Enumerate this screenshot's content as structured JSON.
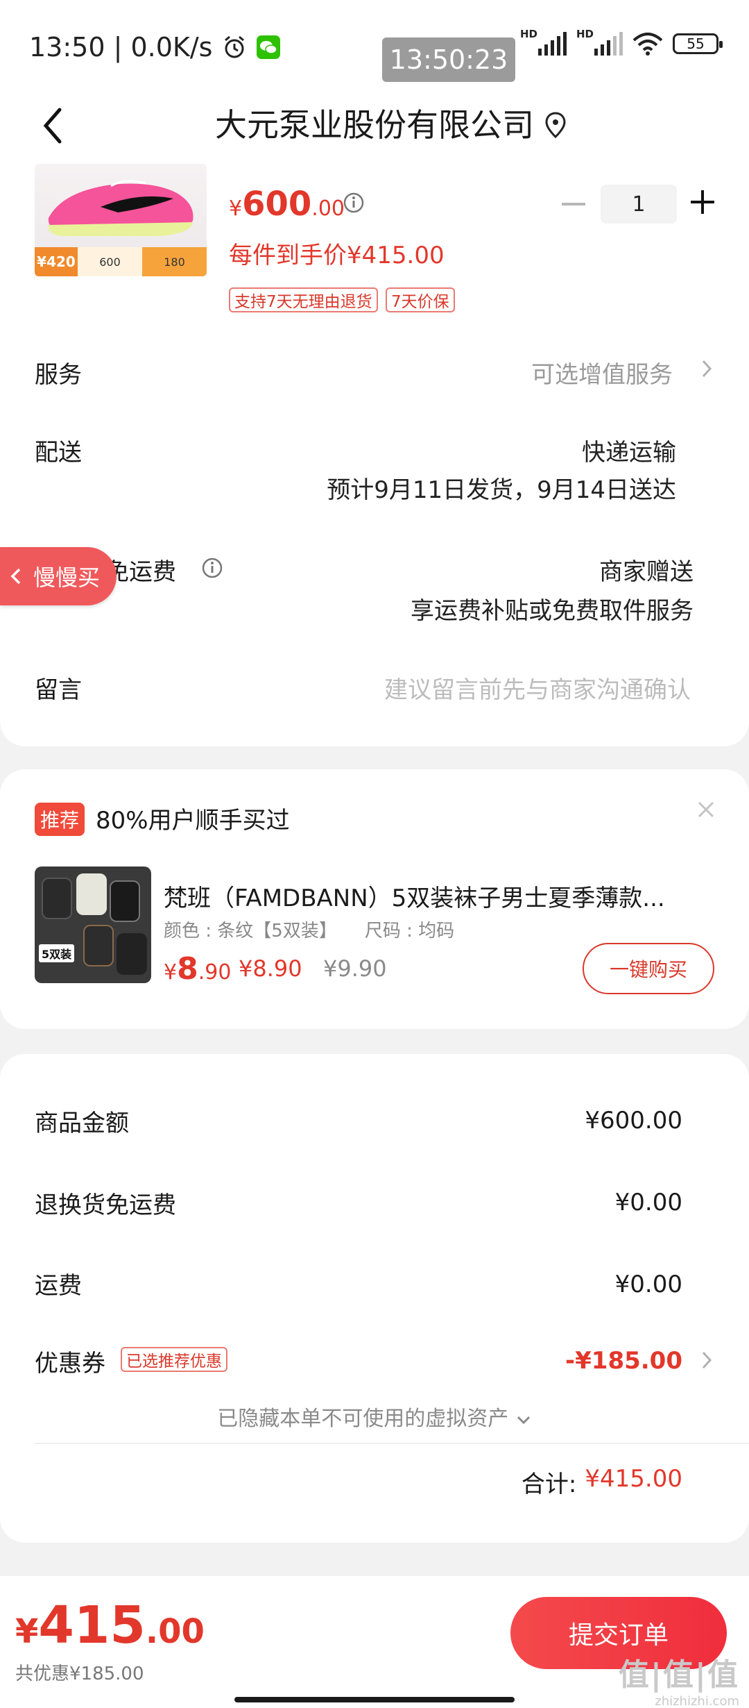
{
  "status_bar": {
    "left_text": "13:50 | 0.0K/s",
    "time_badge": "13:50:23",
    "battery": "55",
    "network_label": "HD"
  },
  "nav": {
    "title": "大元泵业股份有限公司"
  },
  "product": {
    "price_currency": "¥",
    "price_int": "600",
    "price_dec": ".00",
    "per_item_price": "每件到手价¥415.00",
    "tags": [
      "支持7天无理由退货",
      "7天价保"
    ],
    "quantity": "1",
    "thumb_promo": {
      "left_price": "¥420",
      "mid_value": "600",
      "right_value": "180"
    }
  },
  "rows": {
    "service_label": "服务",
    "service_value": "可选增值服务",
    "delivery_label": "配送",
    "delivery_method": "快递运输",
    "delivery_eta": "预计9月11日发货，9月14日送达",
    "return_label": "退换货免运费",
    "return_value_1": "商家赠送",
    "return_value_2": "享运费补贴或免费取件服务",
    "message_label": "留言",
    "message_placeholder": "建议留言前先与商家沟通确认"
  },
  "float_button": {
    "label": "慢慢买"
  },
  "recommendation": {
    "badge": "推荐",
    "title": "80%用户顺手买过",
    "item_name": "梵班（FAMDBANN）5双装袜子男士夏季薄款...",
    "spec_color": "颜色 : 条纹【5双装】",
    "spec_size": "尺码 : 均码",
    "price_currency": "¥",
    "price_int": "8",
    "price_dec": ".90",
    "price_alt": "¥8.90",
    "price_original": "¥9.90",
    "thumb_label": "5双装",
    "buy_label": "一键购买"
  },
  "summary": {
    "goods_label": "商品金额",
    "goods_value": "¥600.00",
    "return_fee_label": "退换货免运费",
    "return_fee_value": "¥0.00",
    "shipping_label": "运费",
    "shipping_value": "¥0.00",
    "coupon_label": "优惠券",
    "coupon_tag": "已选推荐优惠",
    "coupon_value": "-¥185.00",
    "hidden_assets": "已隐藏本单不可使用的虚拟资产",
    "total_label": "合计:",
    "total_value": "¥415.00"
  },
  "bottom": {
    "price_currency": "¥",
    "price_int": "415",
    "price_dec": ".00",
    "saved": "共优惠¥185.00",
    "submit_label": "提交订单",
    "watermark_big": "值|值|值",
    "watermark_small": "zhizhizhi.com"
  },
  "colors": {
    "accent_red": "#e2372b",
    "submit_button": "#f02d3c",
    "float_pill": "#f0595b"
  }
}
